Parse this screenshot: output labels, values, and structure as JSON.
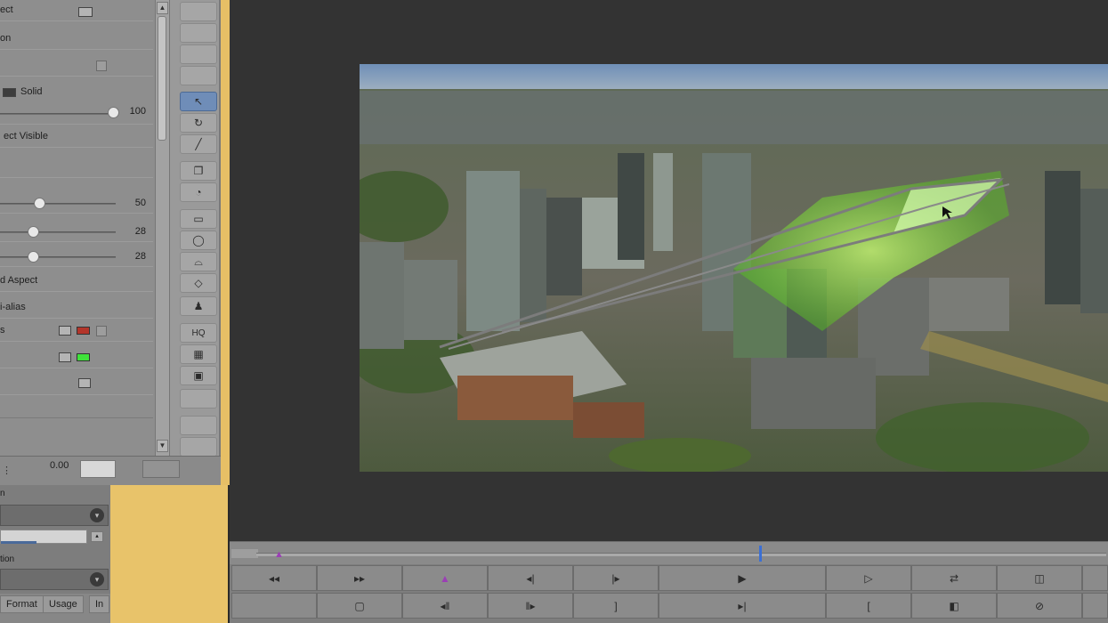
{
  "effect_panel": {
    "rows": [
      {
        "label": "ect"
      },
      {
        "label": "on"
      },
      {
        "label": ""
      },
      {
        "label": "Solid"
      },
      {
        "label": ""
      },
      {
        "label": "ect Visible"
      },
      {
        "label": ""
      },
      {
        "label": ""
      },
      {
        "label": ""
      },
      {
        "label": ""
      },
      {
        "label": "d Aspect"
      },
      {
        "label": "i-alias"
      },
      {
        "label": "s"
      }
    ],
    "opacity_value": "100",
    "slider1_value": "50",
    "slider2_value": "28",
    "slider3_value": "28",
    "bottom_value": "0.00"
  },
  "lower_left": {
    "label1": "n",
    "label2": "tion",
    "tabs": [
      "Format",
      "Usage",
      "In"
    ]
  },
  "tools": {
    "hq_label": "HQ"
  },
  "colors": {
    "viewer_bg": "#333333",
    "panel_bg": "#8e8e8e",
    "accent_yellow": "#e8c36a",
    "selection_blue": "#6f8db8",
    "tracked_green": "#7ed321"
  }
}
